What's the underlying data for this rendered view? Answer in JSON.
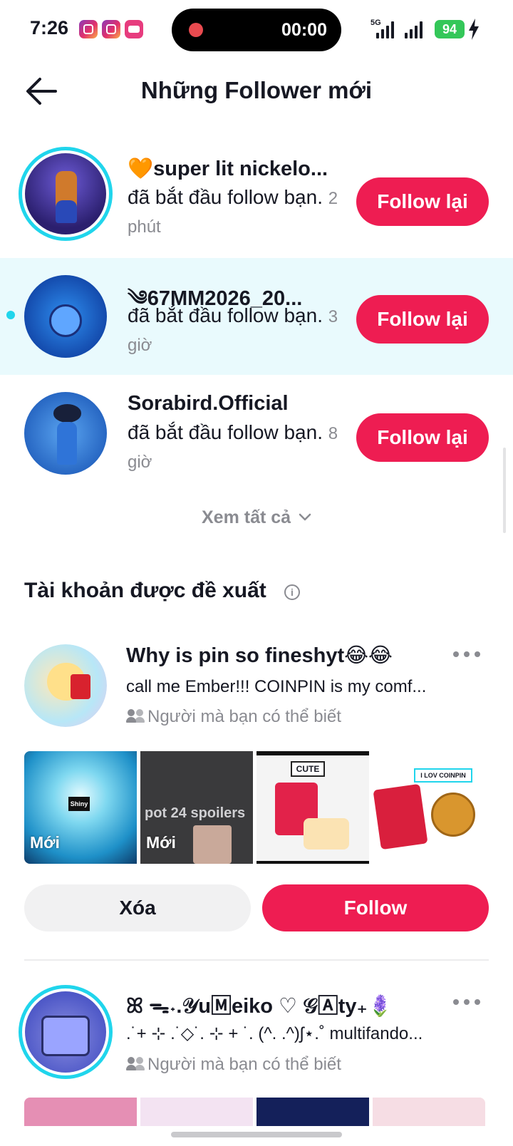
{
  "status_bar": {
    "time": "7:26",
    "recording_time": "00:00",
    "network": "5G",
    "battery": "94"
  },
  "header": {
    "title": "Những Follower mới"
  },
  "followers": [
    {
      "name": "🧡super lit nickelo...",
      "action": "đã bắt đầu follow bạn.",
      "time": "2 phút",
      "button": "Follow lại",
      "unread": false
    },
    {
      "name": "༄67MM2026_20...",
      "action": "đã bắt đầu follow bạn.",
      "time": "3 giờ",
      "button": "Follow lại",
      "unread": true
    },
    {
      "name": "Sorabird.Official",
      "action": "đã bắt đầu follow bạn.",
      "time": "8 giờ",
      "button": "Follow lại",
      "unread": false
    }
  ],
  "see_all": "Xem tất cả",
  "suggested": {
    "title": "Tài khoản được đề xuất",
    "accounts": [
      {
        "name": "Why is pin so fineshyt😂😂",
        "bio": "call me Ember!!! COINPIN is my comf...",
        "reason": "Người mà bạn có thể biết",
        "thumbnails": [
          {
            "badge": "Mới",
            "label": "Shiny"
          },
          {
            "badge": "Mới",
            "label": "pot 24 spoilers"
          },
          {
            "badge": "",
            "label": "CUTE"
          },
          {
            "badge": "",
            "label": "I LOV COINPIN"
          }
        ],
        "remove_label": "Xóa",
        "follow_label": "Follow"
      },
      {
        "name": "ꕤ ᯓ˖.𝒴u🄼eiko ♡ 𝒢🄰ty₊🪻",
        "bio": ".˙+ ⊹ .˙◇˙. ⊹ + ˙. (^. .^)ʃ⋆.˚ multifando...",
        "reason": "Người mà bạn có thể biết"
      }
    ]
  },
  "colors": {
    "accent": "#ee1d52",
    "highlight_row": "#e9fafd",
    "ring": "#20d5ec",
    "secondary_text": "#8a8b91"
  }
}
